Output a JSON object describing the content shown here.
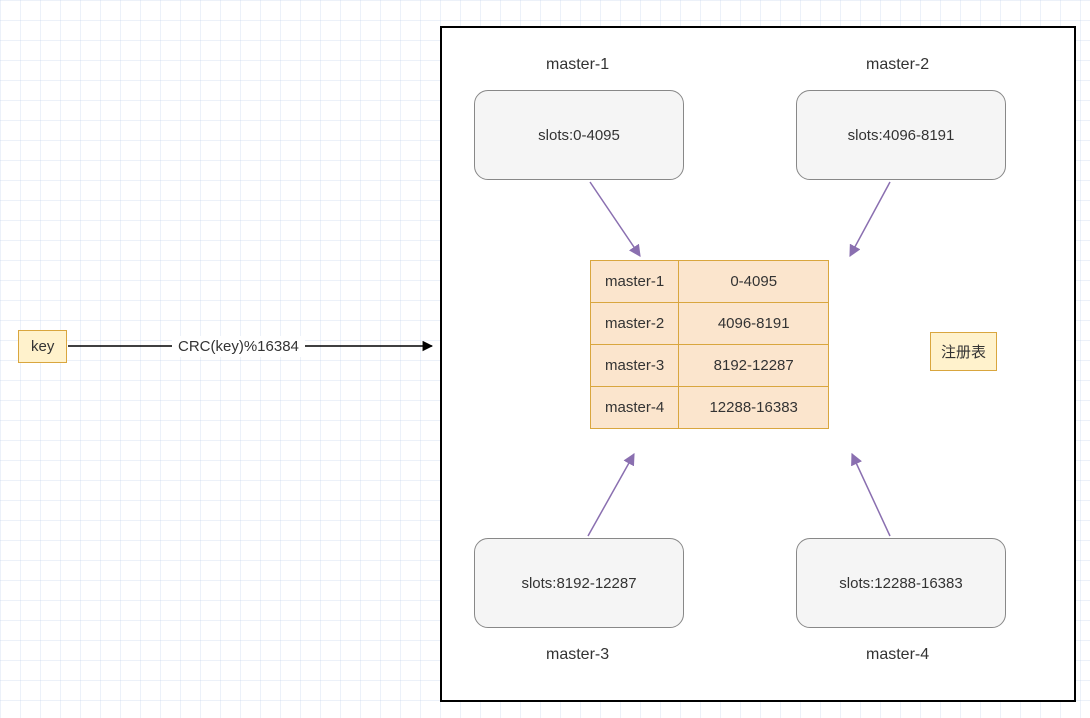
{
  "key_label": "key",
  "edge_formula": "CRC(key)%16384",
  "masters": {
    "m1": {
      "name": "master-1",
      "slots": "slots:0-4095"
    },
    "m2": {
      "name": "master-2",
      "slots": "slots:4096-8191"
    },
    "m3": {
      "name": "master-3",
      "slots": "slots:8192-12287"
    },
    "m4": {
      "name": "master-4",
      "slots": "slots:12288-16383"
    }
  },
  "registry_label": "注册表",
  "registry_rows": [
    {
      "name": "master-1",
      "range": "0-4095"
    },
    {
      "name": "master-2",
      "range": "4096-8191"
    },
    {
      "name": "master-3",
      "range": "8192-12287"
    },
    {
      "name": "master-4",
      "range": "12288-16383"
    }
  ]
}
